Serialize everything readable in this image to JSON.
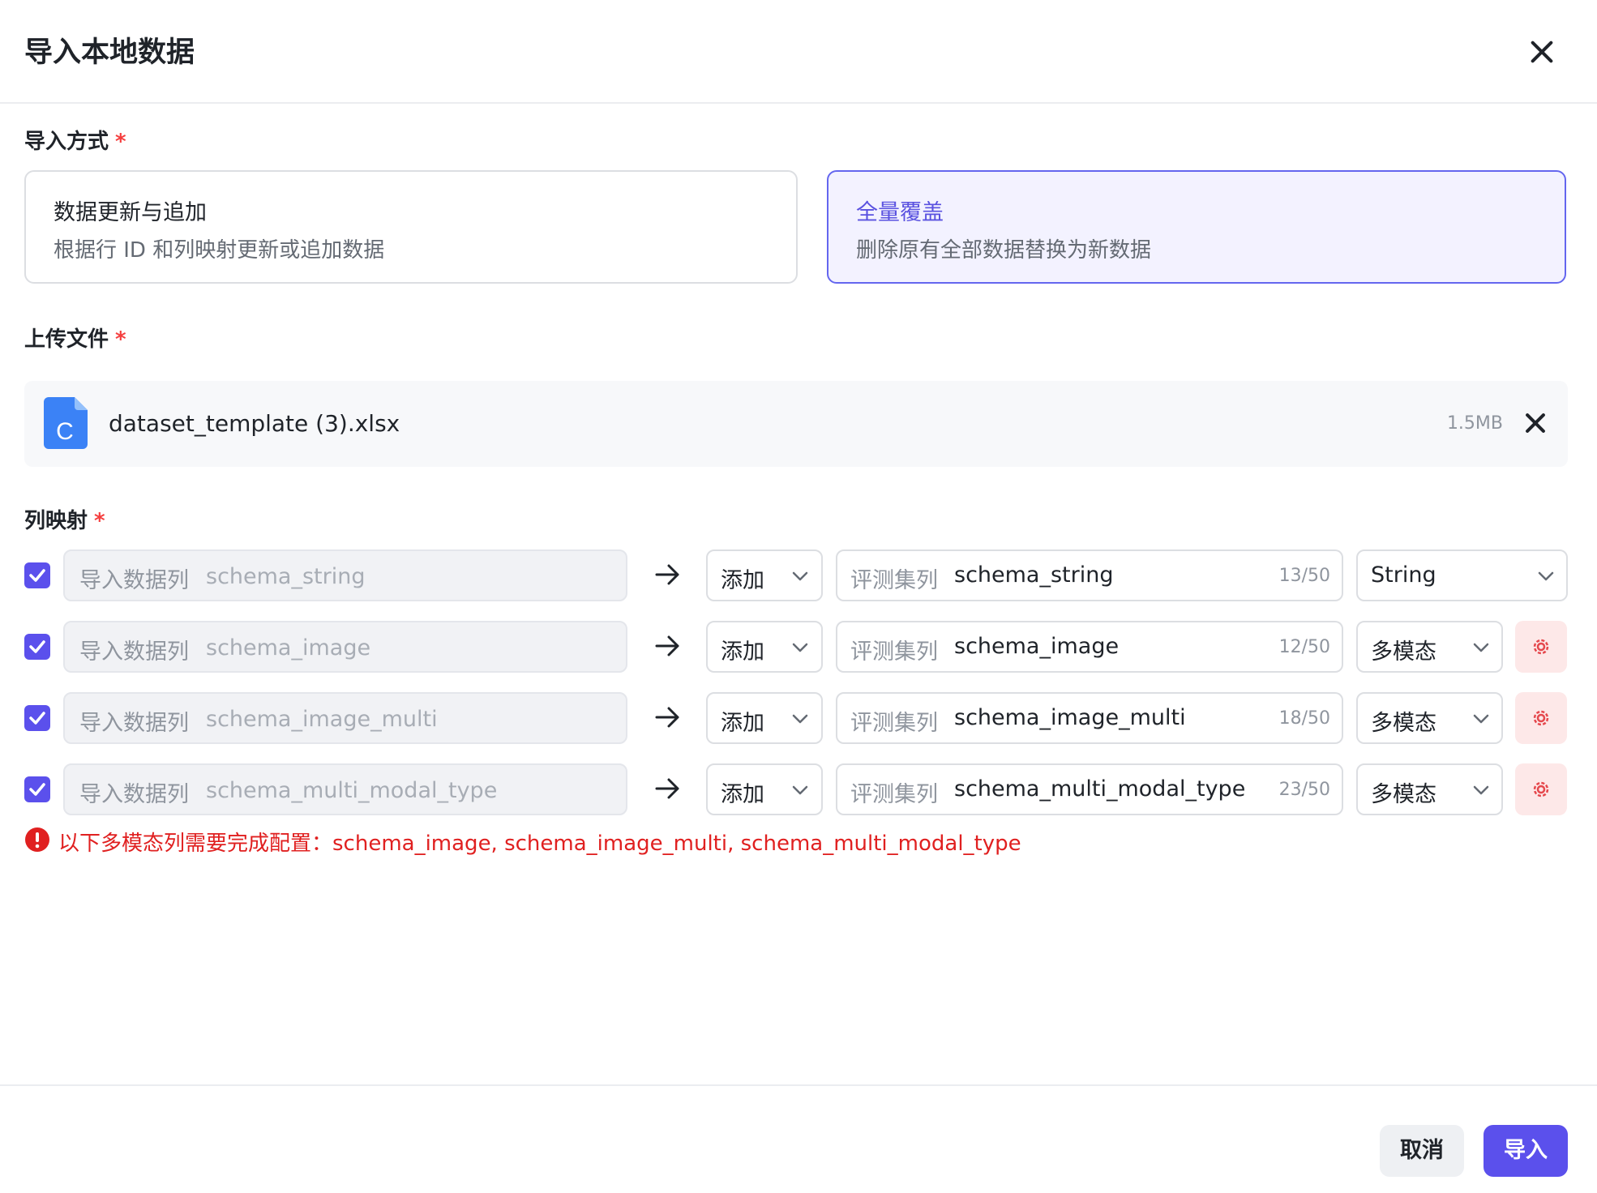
{
  "dialog": {
    "title": "导入本地数据"
  },
  "import_mode": {
    "label": "导入方式",
    "required_mark": "*",
    "options": [
      {
        "title": "数据更新与追加",
        "description": "根据行 ID 和列映射更新或追加数据",
        "selected": false
      },
      {
        "title": "全量覆盖",
        "description": "删除原有全部数据替换为新数据",
        "selected": true
      }
    ]
  },
  "upload": {
    "label": "上传文件",
    "required_mark": "*",
    "file_icon_letter": "C",
    "file_name": "dataset_template (3).xlsx",
    "file_size": "1.5MB"
  },
  "mapping": {
    "label": "列映射",
    "required_mark": "*",
    "rows": [
      {
        "checked": true,
        "source_label": "导入数据列",
        "source_value": "schema_string",
        "action": "添加",
        "target_label": "评测集列",
        "target_value": "schema_string",
        "count": "13/50",
        "type": "String",
        "has_config": false
      },
      {
        "checked": true,
        "source_label": "导入数据列",
        "source_value": "schema_image",
        "action": "添加",
        "target_label": "评测集列",
        "target_value": "schema_image",
        "count": "12/50",
        "type": "多模态",
        "has_config": true
      },
      {
        "checked": true,
        "source_label": "导入数据列",
        "source_value": "schema_image_multi",
        "action": "添加",
        "target_label": "评测集列",
        "target_value": "schema_image_multi",
        "count": "18/50",
        "type": "多模态",
        "has_config": true
      },
      {
        "checked": true,
        "source_label": "导入数据列",
        "source_value": "schema_multi_modal_type",
        "action": "添加",
        "target_label": "评测集列",
        "target_value": "schema_multi_modal_type",
        "count": "23/50",
        "type": "多模态",
        "has_config": true
      }
    ],
    "error": "以下多模态列需要完成配置：schema_image, schema_image_multi, schema_multi_modal_type"
  },
  "footer": {
    "cancel_label": "取消",
    "submit_label": "导入"
  },
  "colors": {
    "accent": "#5b50ec",
    "error": "#e02020",
    "selected_card_bg": "#f3f2ff",
    "config_button_bg": "#fde8e8"
  },
  "icons": [
    "close-icon",
    "file-icon",
    "checkbox-checked-icon",
    "arrow-right-icon",
    "chevron-down-icon",
    "gear-icon",
    "error-icon"
  ]
}
